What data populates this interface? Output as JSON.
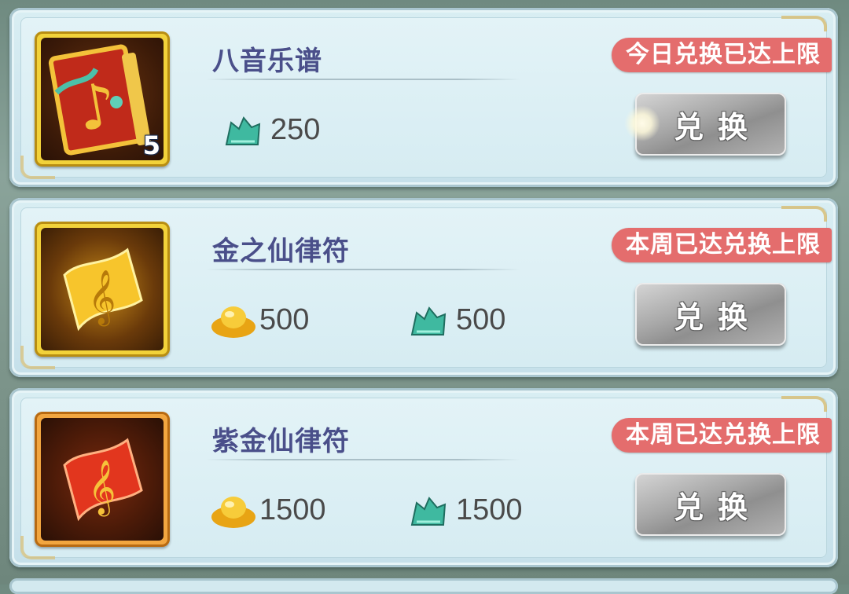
{
  "items": [
    {
      "name": "八音乐谱",
      "quantity": "5",
      "limit_badge": "今日兑换已达上限",
      "icon": "music-book-icon",
      "frame": "gold",
      "prices": [
        {
          "currency_icon": "jade-ticket-icon",
          "amount": "250"
        }
      ],
      "button_label": "兑换"
    },
    {
      "name": "金之仙律符",
      "limit_badge": "本周已达兑换上限",
      "icon": "gold-talisman-icon",
      "frame": "gold",
      "prices": [
        {
          "currency_icon": "gold-ingot-icon",
          "amount": "500"
        },
        {
          "currency_icon": "jade-ticket-icon",
          "amount": "500"
        }
      ],
      "button_label": "兑换"
    },
    {
      "name": "紫金仙律符",
      "limit_badge": "本周已达兑换上限",
      "icon": "red-talisman-icon",
      "frame": "orange",
      "prices": [
        {
          "currency_icon": "gold-ingot-icon",
          "amount": "1500"
        },
        {
          "currency_icon": "jade-ticket-icon",
          "amount": "1500"
        }
      ],
      "button_label": "兑换"
    }
  ],
  "colors": {
    "badge": "#e46d6d",
    "name_text": "#4a4f8a",
    "button_disabled": "#a9a9a9"
  }
}
